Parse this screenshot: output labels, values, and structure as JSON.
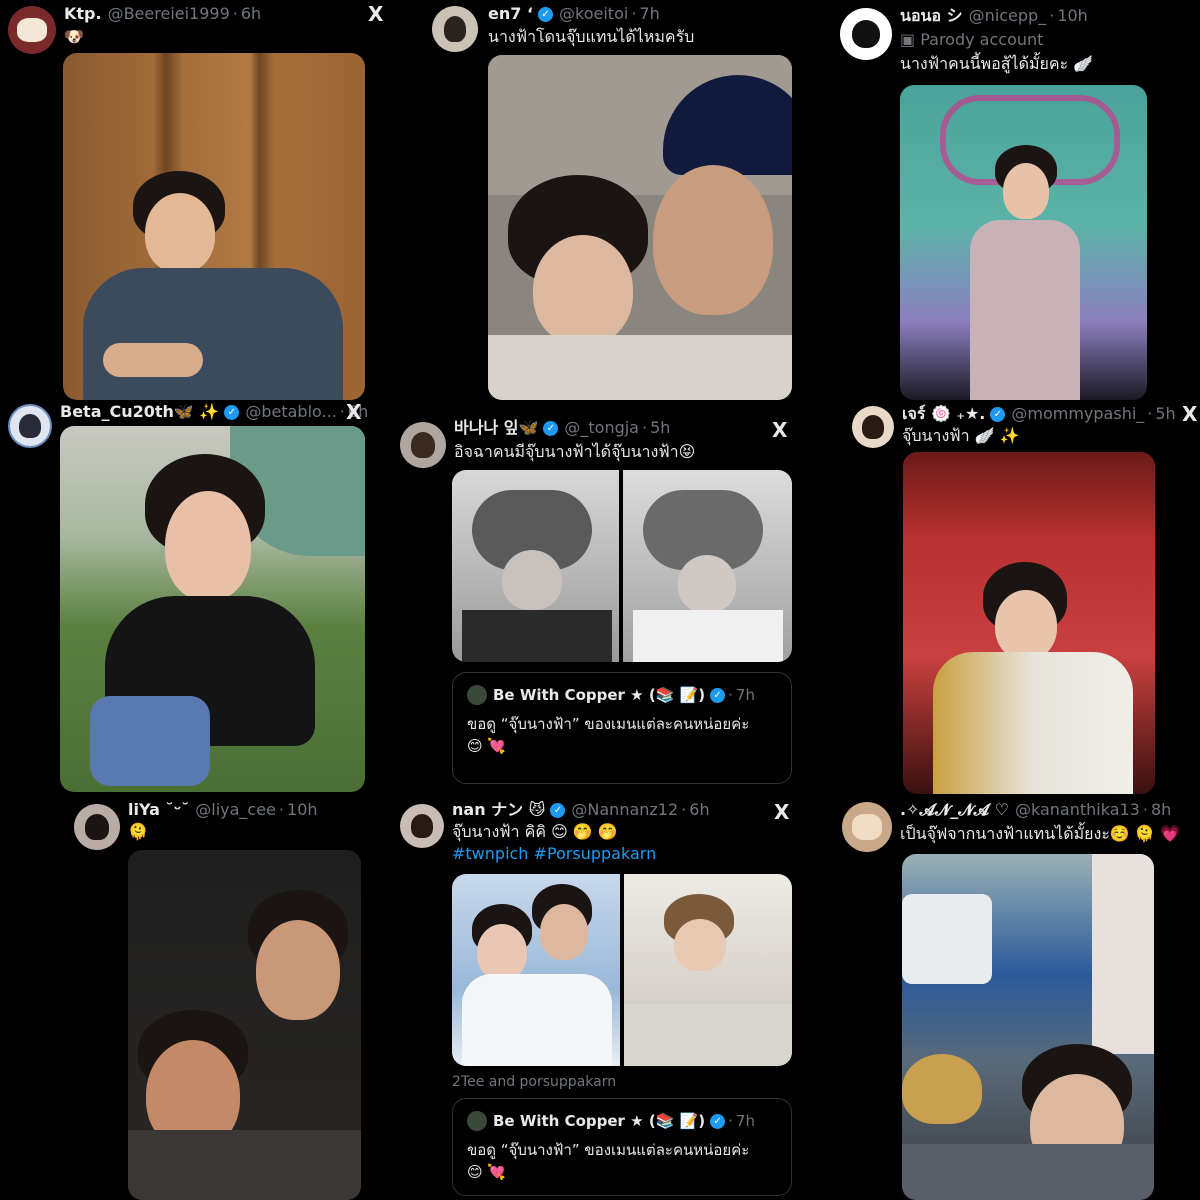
{
  "tweets": [
    {
      "name": "Ktp.",
      "handle": "@Beereiei1999",
      "time": "6h",
      "text": "🐶",
      "verified": false
    },
    {
      "name": "en7 ‘",
      "handle": "@koeitoi",
      "time": "7h",
      "text": "นางฟ้าโดนจุ๊บแทนได้ไหมครับ",
      "verified": true
    },
    {
      "name": "นอนอ シ",
      "handle": "@nicepp_",
      "time": "10h",
      "parody": "Parody account",
      "text": "นางฟ้าคนนี้พอสู้ได้มั้ยคะ 🪽",
      "verified": false
    },
    {
      "name": "Beta_Cu20th🦋 ✨",
      "handle": "@betablo...",
      "time": "6h",
      "text": "",
      "verified": true
    },
    {
      "name": "바나나 잎🦋",
      "handle": "@_tongja",
      "time": "5h",
      "text": "อิจฉาคนมีจุ๊บนางฟ้าได้จุ๊บนางฟ้า😝",
      "verified": true,
      "quote": {
        "name": "Be With Copper ★ (📚 📝)",
        "time": "7h",
        "line1": "ขอดู “จุ๊บนางฟ้า” ของเมนแต่ละคนหน่อยค่ะ",
        "line2": "😊 💘"
      }
    },
    {
      "name": "เจร์ 🍥 ₊★.",
      "handle": "@mommypashi_",
      "time": "5h",
      "text": "จุ๊บนางฟ้า 🪽 ✨",
      "verified": true
    },
    {
      "name": "liYa ˘ᵕ˘",
      "handle": "@liya_cee",
      "time": "10h",
      "text": "🫠",
      "verified": false
    },
    {
      "name": "nan ナン 😼",
      "handle": "@Nannanz12",
      "time": "6h",
      "text": "จุ๊บนางฟ้า คิคิ 😊 🤭 🤭",
      "hashtags": "#twnpich #Porsuppakarn",
      "caption": "2Tee and porsuppakarn",
      "verified": true,
      "quote": {
        "name": "Be With Copper ★ (📚 📝)",
        "time": "7h",
        "line1": "ขอดู “จุ๊บนางฟ้า” ของเมนแต่ละคนหน่อยค่ะ",
        "line2": "😊 💘"
      }
    },
    {
      "name": ".✧𝓐𝓝_𝓝𝓐 ♡",
      "handle": "@kananthika13",
      "time": "8h",
      "text": "เป็นจุ๊ฟจากนางฟ้าแทนได้มั้ยงะ☺️ 🫠 💗",
      "verified": false
    }
  ],
  "icons": {
    "x": "X",
    "verified": "✓"
  },
  "colors": {
    "background": "#000000",
    "text": "#e7e9ea",
    "muted": "#71767b",
    "link": "#1d9bf0",
    "verified": "#1d9bf0"
  }
}
